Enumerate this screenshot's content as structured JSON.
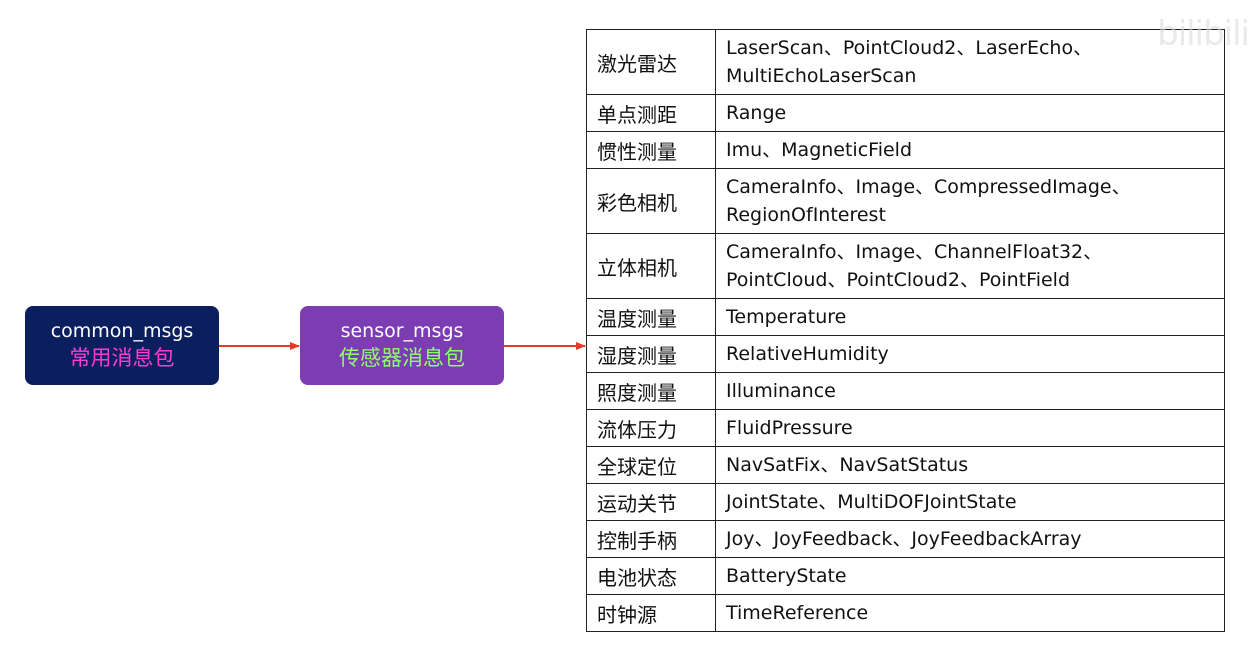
{
  "nodes": {
    "common": {
      "en": "common_msgs",
      "zh": "常用消息包"
    },
    "sensor": {
      "en": "sensor_msgs",
      "zh": "传感器消息包"
    }
  },
  "colors": {
    "common_bg": "#0b1e5e",
    "sensor_bg": "#7b3db1",
    "common_zh": "#ff3cd6",
    "sensor_zh": "#8fff6a",
    "arrow": "#e53a2a"
  },
  "table": {
    "rows": [
      {
        "category": "激光雷达",
        "messages": [
          "LaserScan、PointCloud2、LaserEcho、",
          "MultiEchoLaserScan"
        ]
      },
      {
        "category": "单点测距",
        "messages": [
          "Range"
        ]
      },
      {
        "category": "惯性测量",
        "messages": [
          "Imu、MagneticField"
        ]
      },
      {
        "category": "彩色相机",
        "messages": [
          "CameraInfo、Image、CompressedImage、",
          "RegionOfInterest"
        ]
      },
      {
        "category": "立体相机",
        "messages": [
          "CameraInfo、Image、ChannelFloat32、",
          "PointCloud、PointCloud2、PointField"
        ]
      },
      {
        "category": "温度测量",
        "messages": [
          "Temperature"
        ]
      },
      {
        "category": "湿度测量",
        "messages": [
          "RelativeHumidity"
        ]
      },
      {
        "category": "照度测量",
        "messages": [
          "Illuminance"
        ]
      },
      {
        "category": "流体压力",
        "messages": [
          "FluidPressure"
        ]
      },
      {
        "category": "全球定位",
        "messages": [
          "NavSatFix、NavSatStatus"
        ]
      },
      {
        "category": "运动关节",
        "messages": [
          "JointState、MultiDOFJointState"
        ]
      },
      {
        "category": "控制手柄",
        "messages": [
          "Joy、JoyFeedback、JoyFeedbackArray"
        ]
      },
      {
        "category": "电池状态",
        "messages": [
          "BatteryState"
        ]
      },
      {
        "category": "时钟源",
        "messages": [
          "TimeReference"
        ]
      }
    ]
  },
  "watermark": "bilibili"
}
